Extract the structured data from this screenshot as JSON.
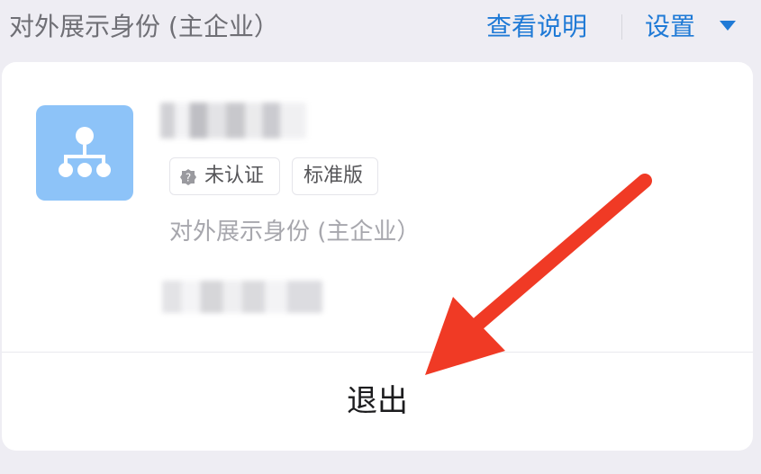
{
  "header": {
    "title": "对外展示身份 (主企业）",
    "help_link": "查看说明",
    "settings_link": "设置",
    "settings_caret_icon": "caret-down-icon",
    "accent_color": "#1f7ad6"
  },
  "card": {
    "avatar_icon": "org-chart-icon",
    "avatar_color": "#8dc3f8",
    "tags": [
      {
        "label": "未认证",
        "icon": "unverified-badge-icon"
      },
      {
        "label": "标准版"
      }
    ],
    "identity_label": "对外展示身份 (主企业）",
    "exit_button": "退出"
  },
  "annotation": {
    "icon": "red-arrow-icon",
    "color": "#f03a25"
  }
}
